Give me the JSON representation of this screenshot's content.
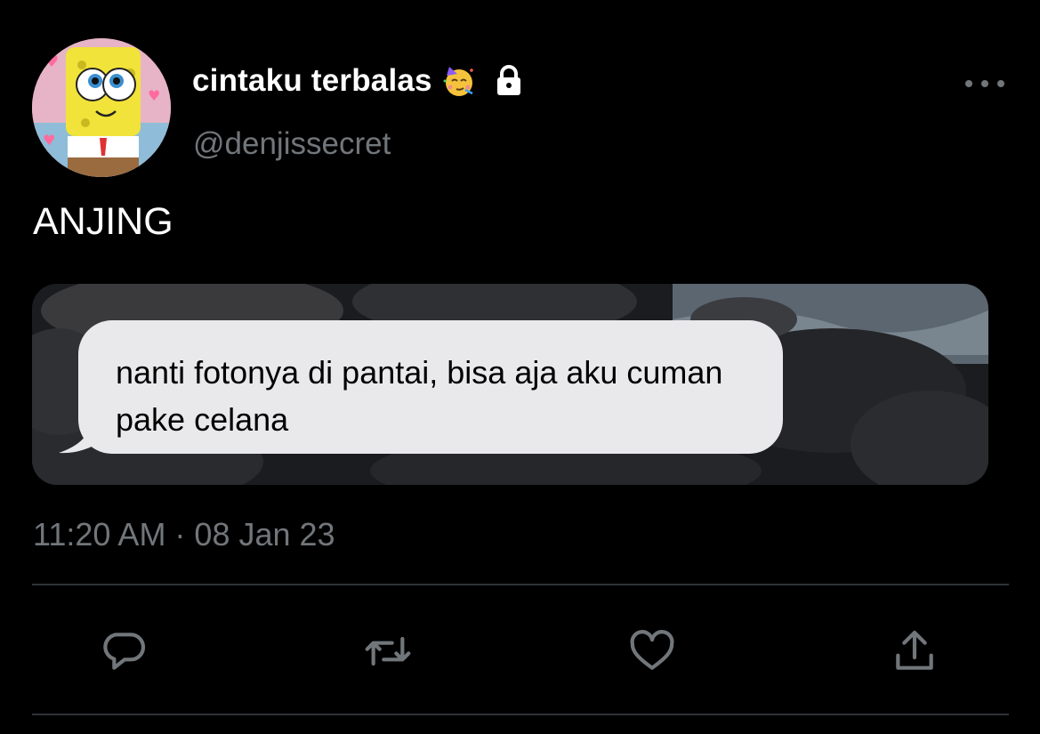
{
  "tweet": {
    "author": {
      "display_name": "cintaku terbalas",
      "emoji_icon": "partying-face-emoji",
      "protected_icon": "lock-icon",
      "handle": "@denjissecret"
    },
    "text": "ANJING",
    "media": {
      "chat_bubble_text": "nanti fotonya di pantai, bisa aja aku cuman pake celana"
    },
    "timestamp": "11:20 AM · 08 Jan 23",
    "actions": [
      "reply-icon",
      "retweet-icon",
      "like-icon",
      "share-icon"
    ]
  },
  "colors": {
    "background": "#000000",
    "primary_text": "#ffffff",
    "secondary_text": "#71767b",
    "divider": "#2f3336",
    "bubble": "#e9e9eb"
  }
}
